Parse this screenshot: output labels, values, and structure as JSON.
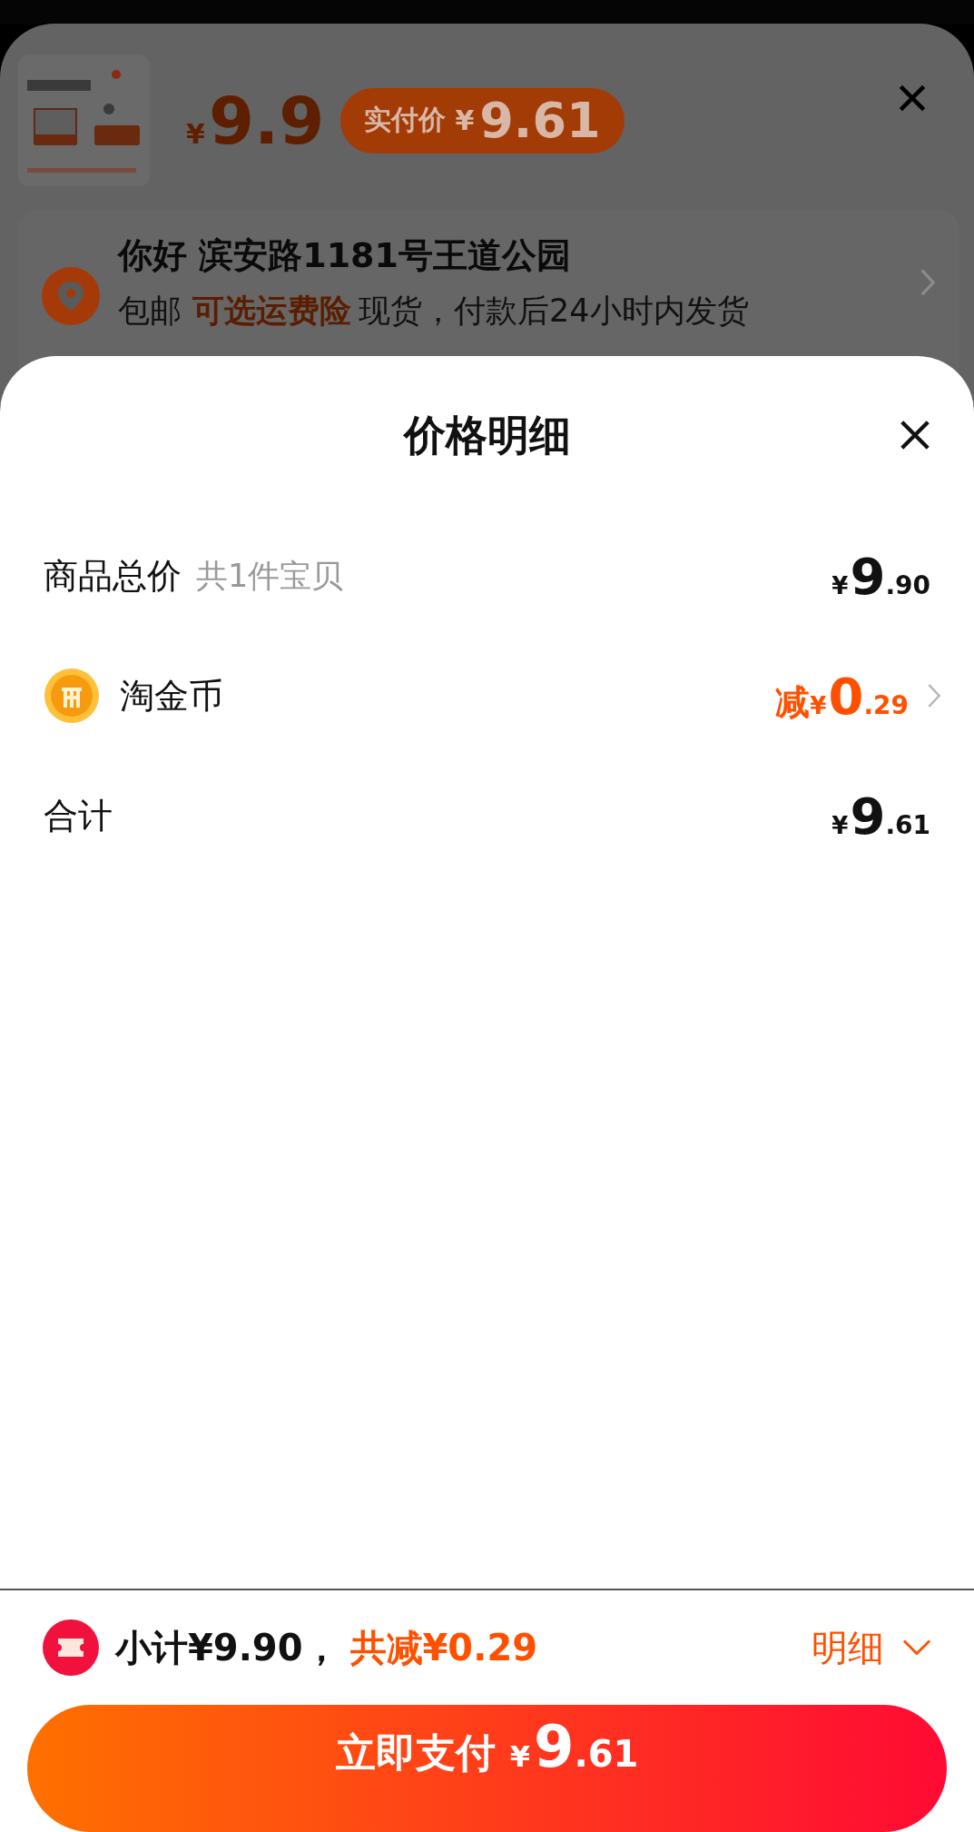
{
  "product_header": {
    "price": {
      "currency": "¥",
      "amount": "9.9"
    },
    "paid_badge": {
      "label": "实付价",
      "currency": "¥",
      "amount": "9.61"
    }
  },
  "address": {
    "title": "你好 滨安路1181号王道公园",
    "shipping": "包邮",
    "insurance_link": "可选运费险",
    "delivery": "现货，付款后24小时内发货"
  },
  "price_sheet": {
    "title": "价格明细",
    "rows": [
      {
        "kind": "goods",
        "label": "商品总价",
        "note": "共1件宝贝",
        "currency": "¥",
        "integer": "9",
        "decimal": ".90"
      },
      {
        "kind": "coin",
        "label": "淘金币",
        "prefix": "减",
        "currency": "¥",
        "integer": "0",
        "decimal": ".29"
      },
      {
        "kind": "sum",
        "label": "合计",
        "currency": "¥",
        "integer": "9",
        "decimal": ".61"
      }
    ]
  },
  "footer": {
    "subtotal": "小计¥9.90，",
    "discount": "共减¥0.29",
    "detail_link": "明细",
    "pay_button": {
      "label": "立即支付",
      "currency": "¥",
      "integer": "9",
      "decimal": ".61"
    }
  }
}
